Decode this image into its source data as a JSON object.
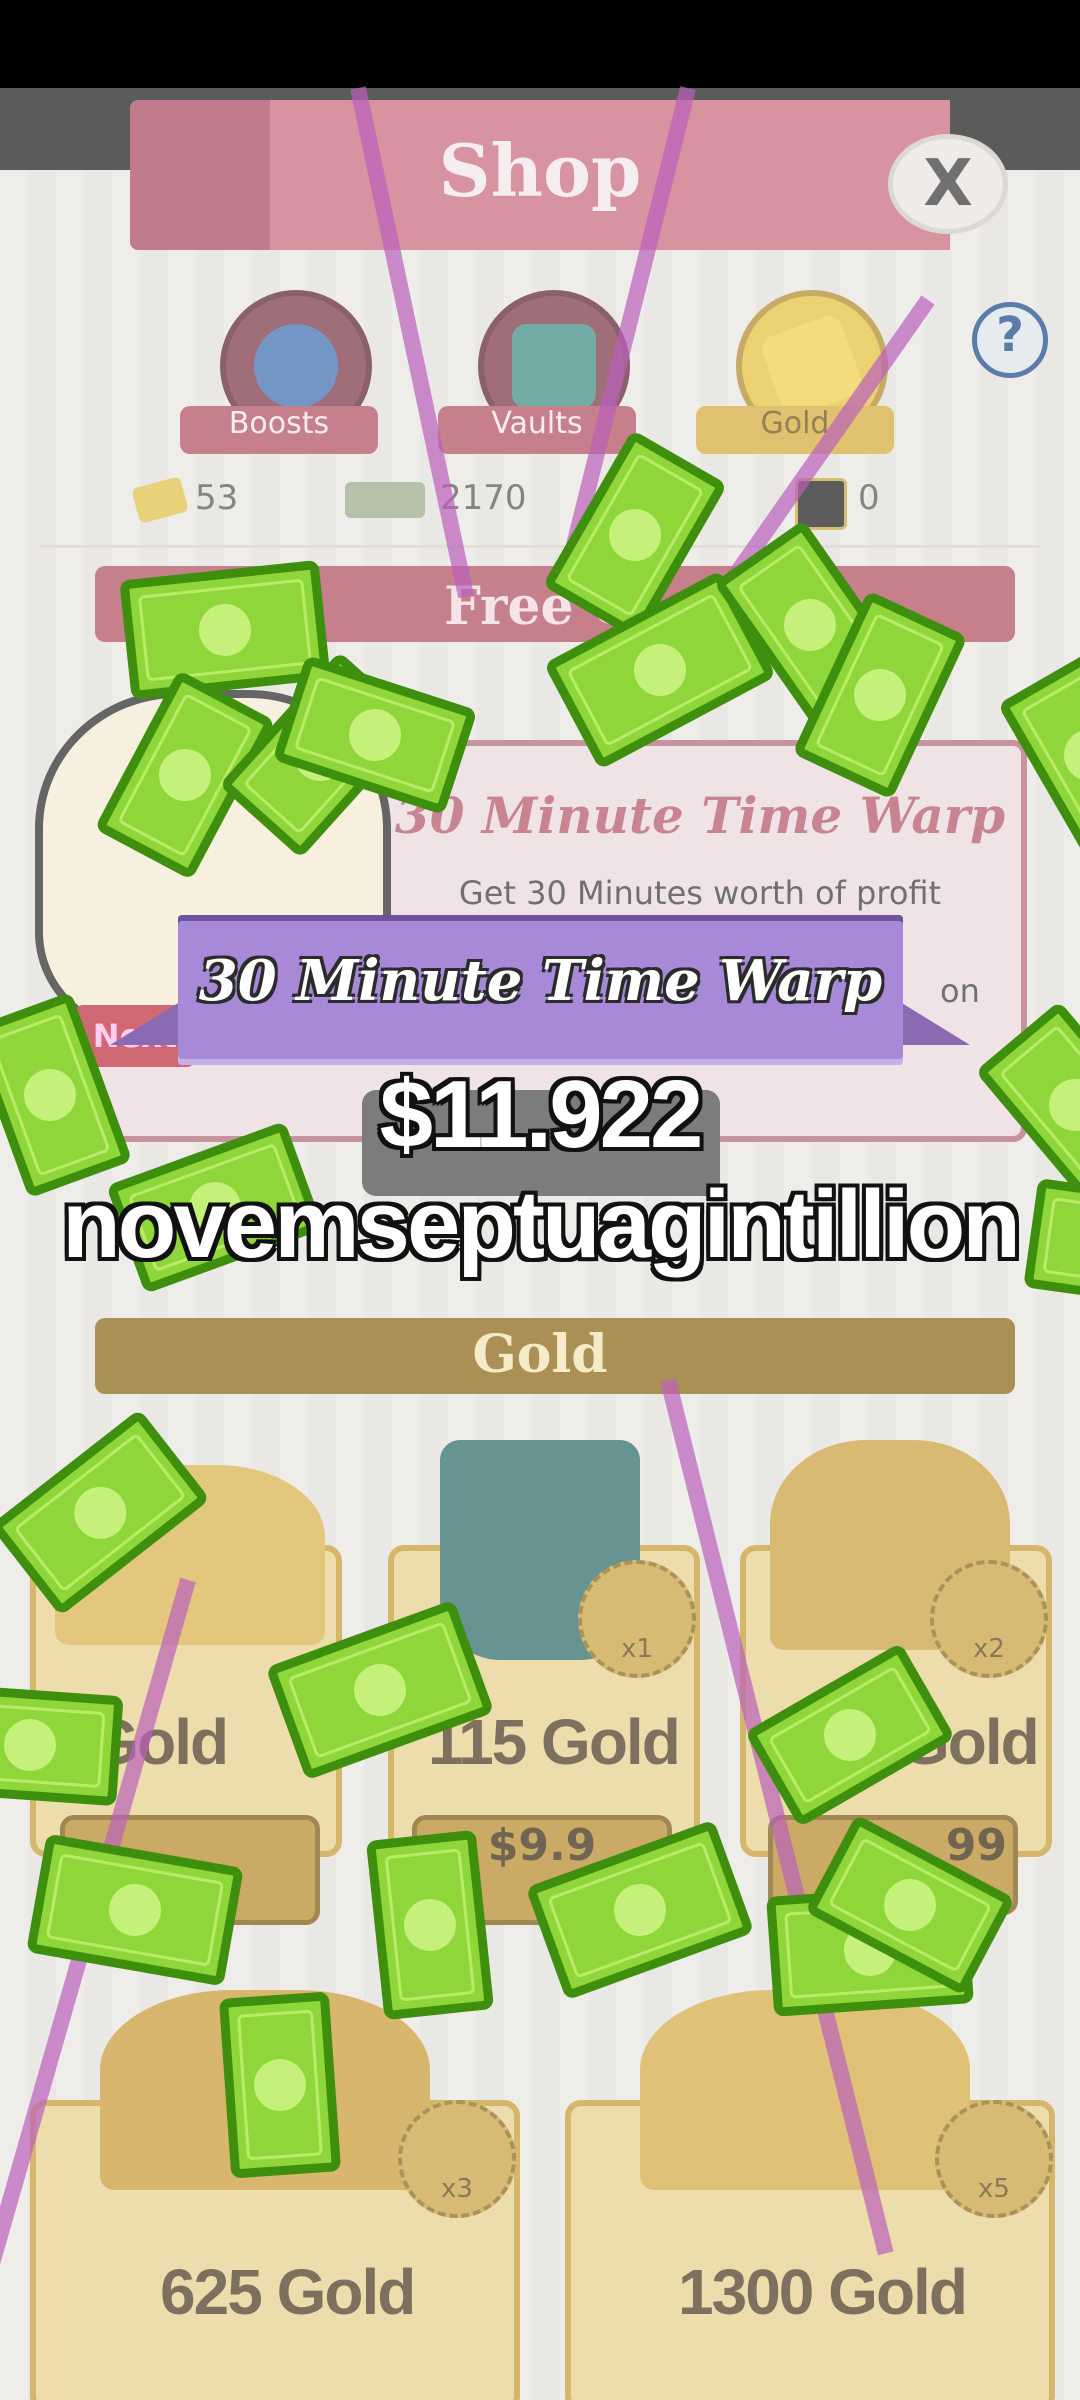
{
  "shop": {
    "title": "Shop",
    "close_label": "X",
    "help_label": "?",
    "tabs": [
      {
        "label": "Boosts",
        "icon": "moneybag-boost-icon"
      },
      {
        "label": "Vaults",
        "icon": "vault-icon"
      },
      {
        "label": "Gold",
        "icon": "gold-bars-icon"
      }
    ],
    "currencies": [
      {
        "icon": "gold-icon",
        "value": "53"
      },
      {
        "icon": "megabucks-icon",
        "value": "2170"
      },
      {
        "icon": "megaticket-icon",
        "value": "0"
      }
    ],
    "free_section_label": "Free G",
    "free_card": {
      "title": "30 Minute Time Warp",
      "desc_line1": "Get 30 Minutes worth of profit",
      "desc_tail": "on",
      "next_label": "Next"
    },
    "gold_section_label": "Gold",
    "gold_packs": [
      {
        "label": "5 Gold",
        "price": "",
        "multiplier": ""
      },
      {
        "label": "115 Gold",
        "price": "$9.9",
        "multiplier": "x1"
      },
      {
        "label": "Gold",
        "price": "99",
        "multiplier": "x2"
      },
      {
        "label": "625 Gold",
        "price": "",
        "multiplier": "x3"
      },
      {
        "label": "1300 Gold",
        "price": "",
        "multiplier": "x5"
      }
    ]
  },
  "reward_popup": {
    "ribbon_title": "30 Minute Time Warp",
    "amount_line1": "$11.922",
    "amount_line2": "novemseptuagintillion"
  },
  "colors": {
    "ribbon": "#a889d8",
    "bill_green": "#8fd63a",
    "shop_pink": "#b0505f",
    "gold": "#c59c32"
  }
}
